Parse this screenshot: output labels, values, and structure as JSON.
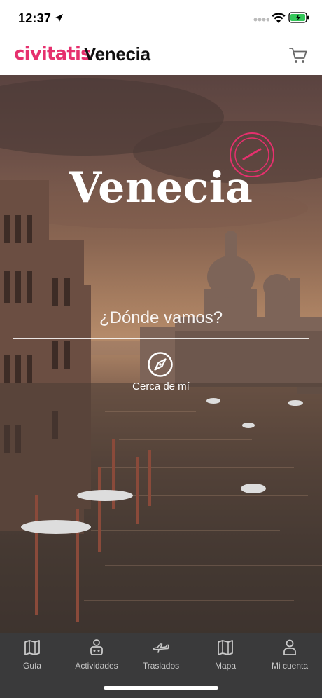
{
  "status_bar": {
    "time": "12:37",
    "icons": [
      "location-arrow-icon",
      "signal-icon",
      "wifi-icon",
      "battery-charging-icon"
    ]
  },
  "header": {
    "brand": "civitatis",
    "title": "Venecia",
    "cart_icon": "shopping-cart-icon",
    "brand_color": "#e6306e"
  },
  "hero": {
    "title": "Venecia",
    "seal_icon": "civitatis-seal-stamp",
    "search_placeholder": "¿Dónde vamos?",
    "search_value": "",
    "near_me_label": "Cerca de mí",
    "near_me_icon": "compass-icon"
  },
  "tabs": [
    {
      "label": "Guía",
      "icon": "map-guide-icon"
    },
    {
      "label": "Actividades",
      "icon": "activities-person-icon"
    },
    {
      "label": "Traslados",
      "icon": "transfer-plane-icon"
    },
    {
      "label": "Mapa",
      "icon": "map-icon"
    },
    {
      "label": "Mi cuenta",
      "icon": "account-person-icon"
    }
  ],
  "colors": {
    "tab_bar_bg": "#3a3a3b",
    "tab_label": "#c9c9c9"
  }
}
